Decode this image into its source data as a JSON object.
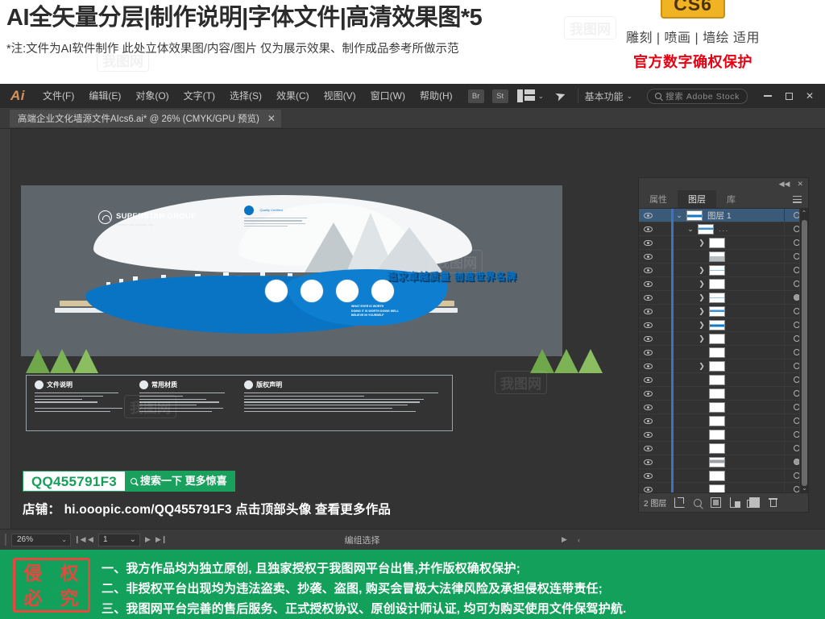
{
  "promo": {
    "title": "AI全矢量分层|制作说明|字体文件|高清效果图*5",
    "subtitle": "*注:文件为AI软件制作 此处立体效果图/内容/图片 仅为展示效果、制作成品参考所做示范",
    "cs6_badge": "CS6",
    "apply_text": "雕刻 | 喷画 | 墙绘 适用",
    "protect_text": "官方数字确权保护",
    "protect_color": "#e60012"
  },
  "app": {
    "logo": "Ai",
    "menus": [
      {
        "label": "文件(F)"
      },
      {
        "label": "编辑(E)"
      },
      {
        "label": "对象(O)"
      },
      {
        "label": "文字(T)"
      },
      {
        "label": "选择(S)"
      },
      {
        "label": "效果(C)"
      },
      {
        "label": "视图(V)"
      },
      {
        "label": "窗口(W)"
      },
      {
        "label": "帮助(H)"
      }
    ],
    "bridge_button": "Br",
    "stock_button": "St",
    "workspace": "基本功能",
    "stock_search_placeholder": "搜索 Adobe Stock",
    "window_controls": {
      "minimize": "—",
      "maximize": "□",
      "close": "✕"
    }
  },
  "document": {
    "tab_label": "高端企业文化墙源文件AIcs6.ai* @ 26% (CMYK/GPU 预览)",
    "tab_close": "✕"
  },
  "artwork": {
    "brand_name": "SUPERSTAR GROUP",
    "brand_slogan": "Replace your company logo",
    "slogan_3d": "追求卓越质量 创造世界名牌",
    "english_text": "WHAT EVER IS WORTH\nDOING IT IS WORTH DOING WELL\nBELIEVE IN YOURSELF",
    "info_boxes": [
      {
        "title": "文件说明"
      },
      {
        "title": "常用材质"
      },
      {
        "title": "版权声明"
      }
    ]
  },
  "qq_promo": {
    "qq_id": "QQ455791F3",
    "search_button": "搜索一下 更多惊喜",
    "store_line": "店铺： hi.ooopic.com/QQ455791F3   点击顶部头像 查看更多作品",
    "id_color": "#14a05a",
    "button_color": "#18a05c"
  },
  "panel": {
    "tabs": [
      {
        "label": "属性",
        "active": false
      },
      {
        "label": "图层",
        "active": true
      },
      {
        "label": "库",
        "active": false
      }
    ],
    "collapse_icon": "◀◀",
    "close_icon": "✕",
    "layers": [
      {
        "name": "图层 1",
        "indent": 0,
        "arrow": "⌄",
        "thumb": "blue",
        "selected": true,
        "target": "open"
      },
      {
        "name": "...",
        "indent": 14,
        "arrow": "⌄",
        "thumb": "blue2",
        "selected": false,
        "target": "open"
      },
      {
        "name": "",
        "indent": 28,
        "arrow": "❯",
        "thumb": "tiny",
        "selected": false,
        "target": "open"
      },
      {
        "name": "",
        "indent": 28,
        "arrow": "",
        "thumb": "gray",
        "selected": false,
        "target": "open"
      },
      {
        "name": "",
        "indent": 28,
        "arrow": "❯",
        "thumb": "line",
        "selected": false,
        "target": "open"
      },
      {
        "name": "",
        "indent": 28,
        "arrow": "❯",
        "thumb": "white",
        "selected": false,
        "target": "open"
      },
      {
        "name": "",
        "indent": 28,
        "arrow": "❯",
        "thumb": "line",
        "selected": false,
        "target": "filled"
      },
      {
        "name": "",
        "indent": 28,
        "arrow": "❯",
        "thumb": "blue2",
        "selected": false,
        "target": "open"
      },
      {
        "name": "",
        "indent": 28,
        "arrow": "❯",
        "thumb": "blue",
        "selected": false,
        "target": "open"
      },
      {
        "name": "",
        "indent": 28,
        "arrow": "❯",
        "thumb": "tiny",
        "selected": false,
        "target": "open"
      },
      {
        "name": "",
        "indent": 28,
        "arrow": "",
        "thumb": "white",
        "selected": false,
        "target": "open"
      },
      {
        "name": "",
        "indent": 28,
        "arrow": "❯",
        "thumb": "white",
        "selected": false,
        "target": "open"
      },
      {
        "name": "",
        "indent": 28,
        "arrow": "",
        "thumb": "white",
        "selected": false,
        "target": "open"
      },
      {
        "name": "",
        "indent": 28,
        "arrow": "",
        "thumb": "white",
        "selected": false,
        "target": "open"
      },
      {
        "name": "",
        "indent": 28,
        "arrow": "",
        "thumb": "white",
        "selected": false,
        "target": "open"
      },
      {
        "name": "",
        "indent": 28,
        "arrow": "",
        "thumb": "white",
        "selected": false,
        "target": "open"
      },
      {
        "name": "",
        "indent": 28,
        "arrow": "",
        "thumb": "white",
        "selected": false,
        "target": "open"
      },
      {
        "name": "",
        "indent": 28,
        "arrow": "",
        "thumb": "white",
        "selected": false,
        "target": "open"
      },
      {
        "name": "",
        "indent": 28,
        "arrow": "",
        "thumb": "gray2",
        "selected": false,
        "target": "filled"
      },
      {
        "name": "",
        "indent": 28,
        "arrow": "",
        "thumb": "white",
        "selected": false,
        "target": "open"
      },
      {
        "name": "",
        "indent": 28,
        "arrow": "",
        "thumb": "white",
        "selected": false,
        "target": "open"
      },
      {
        "name": "",
        "indent": 28,
        "arrow": "",
        "thumb": "gray2",
        "selected": false,
        "target": "open"
      },
      {
        "name": "...",
        "indent": 20,
        "arrow": "❯",
        "thumb": "white",
        "selected": false,
        "target": "open"
      },
      {
        "name": "",
        "indent": 28,
        "arrow": "",
        "thumb": "white",
        "selected": false,
        "target": "open"
      }
    ],
    "footer": {
      "count_label": "2 图层",
      "icons": [
        "collect-for-export-icon",
        "locate-object-icon",
        "make-clipping-mask-icon",
        "create-sublayer-icon",
        "create-new-layer-icon",
        "delete-layer-icon"
      ]
    }
  },
  "statusbar": {
    "zoom": "26%",
    "page": "1",
    "status_text": "编组选择",
    "first_icon": "❙◀",
    "prev_icon": "◀",
    "next_icon": "▶",
    "last_icon": "▶❙"
  },
  "footer": {
    "stamp_chars": [
      "侵",
      "权",
      "必",
      "究"
    ],
    "stamp_color": "#e8473f",
    "background": "#12a05a",
    "lines": [
      "一、我方作品均为独立原创, 且独家授权于我图网平台出售,并作版权确权保护;",
      "二、非授权平台出现均为违法盗卖、抄袭、盗图, 购买会冒极大法律风险及承担侵权连带责任;",
      "三、我图网平台完善的售后服务、正式授权协议、原创设计师认证, 均可为购买使用文件保驾护航."
    ]
  },
  "watermark": {
    "text": "我图网"
  }
}
